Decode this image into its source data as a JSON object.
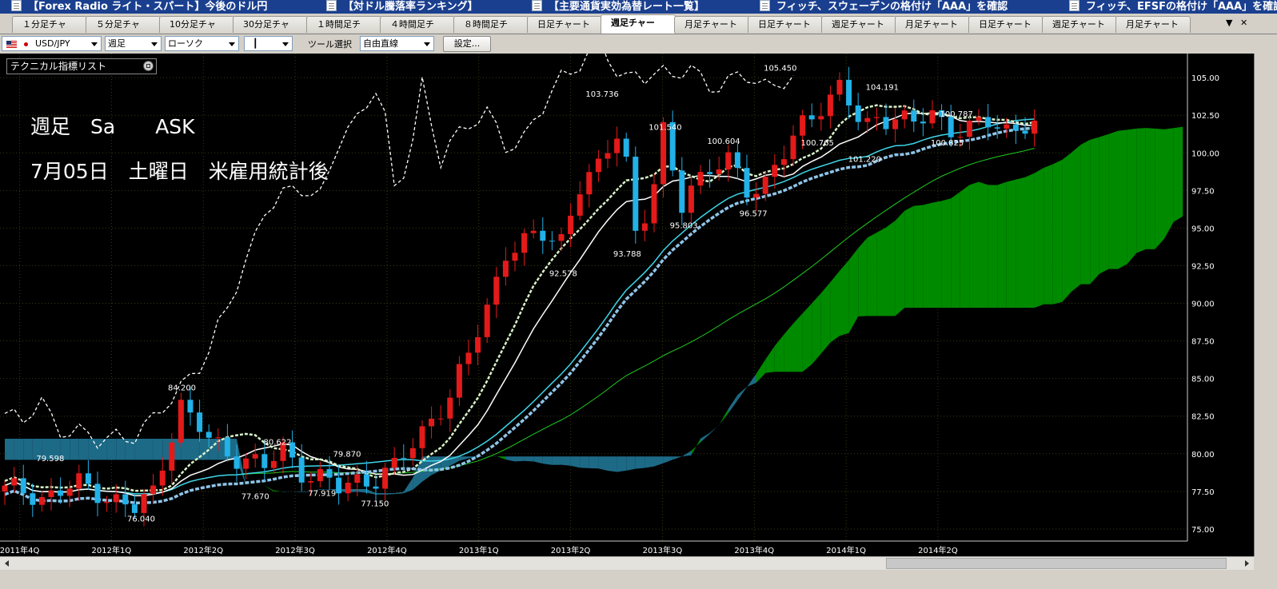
{
  "news_headlines": [
    "【Forex Radio ライト・スパート】今後のドル円",
    "【対ドル騰落率ランキング】",
    "【主要通貨実効為替レート一覧】",
    "フィッチ、スウェーデンの格付け「AAA」を確認",
    "フィッチ、EFSFの格付け「AAA」を確認"
  ],
  "tabs": [
    {
      "label": "１分足チャ"
    },
    {
      "label": "５分足チャ"
    },
    {
      "label": "10分足チャ"
    },
    {
      "label": "30分足チャ"
    },
    {
      "label": "１時間足チ"
    },
    {
      "label": "４時間足チ"
    },
    {
      "label": "８時間足チ"
    },
    {
      "label": "日足チャート"
    },
    {
      "label": "週足チャー",
      "active": true
    },
    {
      "label": "月足チャート"
    },
    {
      "label": "日足チャート"
    },
    {
      "label": "週足チャート"
    },
    {
      "label": "月足チャート"
    },
    {
      "label": "日足チャート"
    },
    {
      "label": "週足チャート"
    },
    {
      "label": "月足チャート"
    }
  ],
  "tab_menu_glyph": "▼",
  "tab_close_glyph": "✕",
  "toolbar": {
    "pair": "USD/JPY",
    "period": "週足",
    "chart_type": "ローソク",
    "candle_glyph": "┃",
    "tool_label": "ツール選択",
    "tool_value": "自由直線",
    "settings_label": "設定..."
  },
  "indicator_box": {
    "title": "テクニカル指標リスト"
  },
  "overlay_text": {
    "line1": "週足　Sa　　ASK",
    "line2": "7月05日　土曜日　米雇用統計後"
  },
  "chart_data": {
    "type": "candlestick",
    "y_ticks": [
      "105.00",
      "102.50",
      "100.00",
      "97.50",
      "95.00",
      "92.50",
      "90.00",
      "87.50",
      "85.00",
      "82.50",
      "80.00",
      "77.50",
      "75.00"
    ],
    "ylim": [
      74.2,
      106.6
    ],
    "x_ticks": [
      "2011年4Q",
      "2012年1Q",
      "2012年2Q",
      "2012年3Q",
      "2012年4Q",
      "2013年1Q",
      "2013年2Q",
      "2013年3Q",
      "2013年4Q",
      "2014年1Q",
      "2014年2Q"
    ],
    "annotations": [
      {
        "text": "105.450",
        "x": 83.6,
        "y": 105.45
      },
      {
        "text": "104.191",
        "x": 94.6,
        "y": 104.19
      },
      {
        "text": "103.736",
        "x": 64.4,
        "y": 103.74
      },
      {
        "text": "101.540",
        "x": 71.2,
        "y": 101.54
      },
      {
        "text": "100.604",
        "x": 77.5,
        "y": 100.6
      },
      {
        "text": "100.787",
        "x": 102.6,
        "y": 102.4
      },
      {
        "text": "100.765",
        "x": 87.6,
        "y": 100.5
      },
      {
        "text": "100.825",
        "x": 101.6,
        "y": 100.5
      },
      {
        "text": "101.220",
        "x": 92.7,
        "y": 99.4
      },
      {
        "text": "95.803",
        "x": 73.2,
        "y": 95.0
      },
      {
        "text": "96.577",
        "x": 80.7,
        "y": 95.8
      },
      {
        "text": "93.788",
        "x": 67.1,
        "y": 93.1
      },
      {
        "text": "92.578",
        "x": 60.2,
        "y": 91.8
      },
      {
        "text": "84.200",
        "x": 19.1,
        "y": 84.2
      },
      {
        "text": "80.622",
        "x": 29.4,
        "y": 80.6
      },
      {
        "text": "79.870",
        "x": 36.9,
        "y": 79.8
      },
      {
        "text": "79.598",
        "x": 4.9,
        "y": 79.5
      },
      {
        "text": "77.670",
        "x": 27.0,
        "y": 77.0
      },
      {
        "text": "77.919",
        "x": 34.2,
        "y": 77.2
      },
      {
        "text": "77.150",
        "x": 39.9,
        "y": 76.5
      },
      {
        "text": "76.040",
        "x": 14.7,
        "y": 75.5
      }
    ]
  },
  "colors": {
    "up": "#e41a1a",
    "down": "#22b1e8",
    "cloud_up": "#008a00",
    "cloud_down": "#1d6a86",
    "background": "#000000",
    "grid": "#4a4a1a"
  }
}
